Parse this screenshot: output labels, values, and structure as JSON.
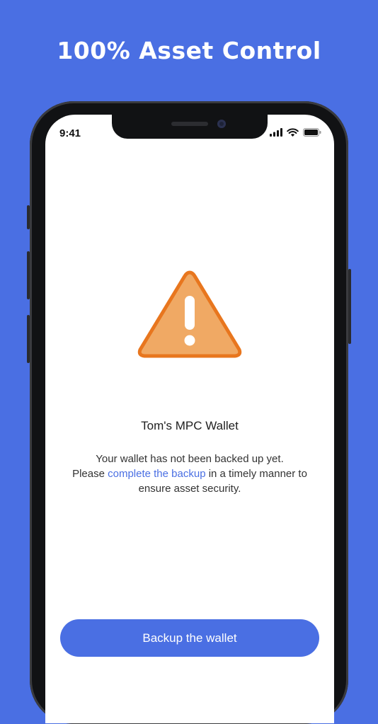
{
  "headline": "100% Asset Control",
  "status_bar": {
    "time": "9:41"
  },
  "wallet": {
    "name": "Tom's MPC Wallet",
    "message_line1": "Your wallet has not been backed up yet.",
    "message_pre_link": "Please ",
    "message_link": "complete the backup",
    "message_post_link": " in a timely manner to ensure asset security."
  },
  "actions": {
    "backup_label": "Backup the wallet"
  },
  "colors": {
    "background": "#4a6fe3",
    "accent": "#4a6fe3",
    "warning_fill": "#f0a964",
    "warning_stroke": "#e8761e"
  },
  "icons": [
    "signal-icon",
    "wifi-icon",
    "battery-icon",
    "warning-icon"
  ]
}
